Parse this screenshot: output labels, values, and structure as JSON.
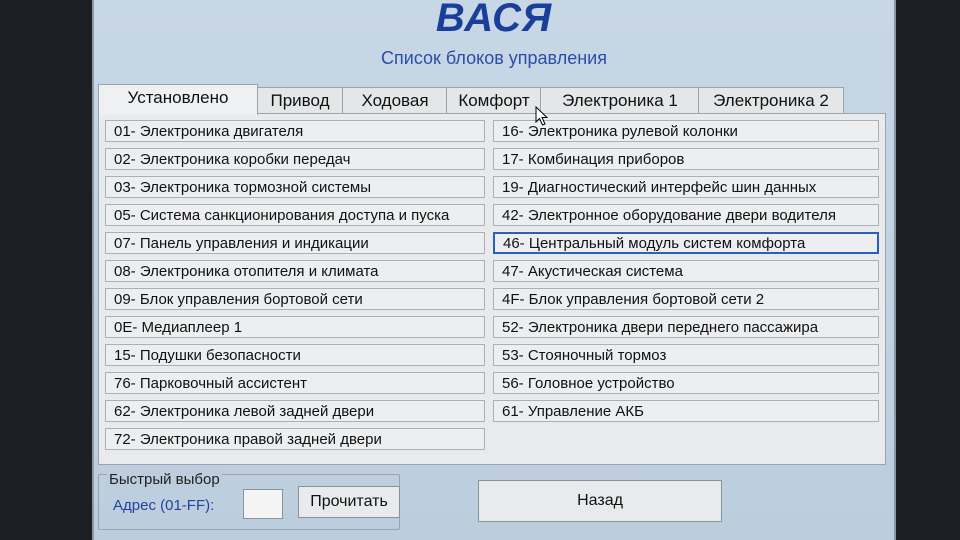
{
  "app": {
    "title": "ВАСЯ",
    "subtitle": "Список блоков управления"
  },
  "tabs": [
    {
      "label": "Установлено",
      "active": true
    },
    {
      "label": "Привод",
      "active": false
    },
    {
      "label": "Ходовая",
      "active": false
    },
    {
      "label": "Комфорт",
      "active": false
    },
    {
      "label": "Электроника 1",
      "active": false
    },
    {
      "label": "Электроника 2",
      "active": false
    }
  ],
  "modules_left": [
    "01- Электроника двигателя",
    "02- Электроника коробки передач",
    "03- Электроника тормозной системы",
    "05- Система санкционирования доступа и пуска",
    "07- Панель управления и индикации",
    "08- Электроника отопителя и климата",
    "09- Блок управления бортовой сети",
    "0E- Медиаплеер 1",
    "15- Подушки безопасности",
    "76- Парковочный ассистент",
    "62- Электроника левой задней двери",
    "72- Электроника правой задней двери"
  ],
  "modules_right": [
    "16- Электроника рулевой колонки",
    "17- Комбинация приборов",
    "19- Диагностический интерфейс шин данных",
    "42- Электронное оборудование двери водителя",
    "46- Центральный модуль систем комфорта",
    "47- Акустическая система",
    "4F- Блок управления бортовой сети 2",
    "52- Электроника двери переднего пассажира",
    "53- Стояночный тормоз",
    "56- Головное устройство",
    "61- Управление АКБ"
  ],
  "selected_module": "46- Центральный модуль систем комфорта",
  "quick_select": {
    "title": "Быстрый выбор",
    "address_label": "Адрес (01-FF):",
    "address_value": "",
    "read_button": "Прочитать"
  },
  "back_button": "Назад",
  "colors": {
    "title": "#1a3f9a",
    "selection_border": "#2a60b8",
    "background": "#c8d7e6"
  }
}
